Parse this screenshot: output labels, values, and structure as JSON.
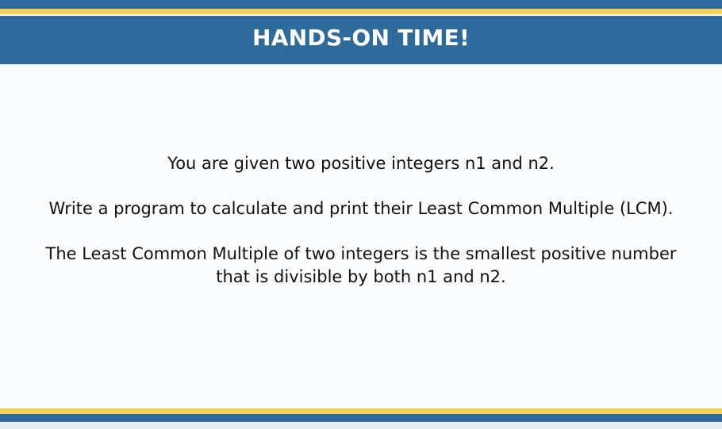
{
  "slide": {
    "title": "HANDS-ON TIME!",
    "paragraphs": [
      "You are given two positive integers n1 and n2.",
      "Write a program to calculate and print their Least Common Multiple (LCM).",
      "The Least Common Multiple of two integers is the smallest positive number that is divisible by both n1 and n2."
    ]
  },
  "colors": {
    "header_blue": "#2f6a9d",
    "stripe_gold": "#f3d257",
    "text": "#111111"
  }
}
